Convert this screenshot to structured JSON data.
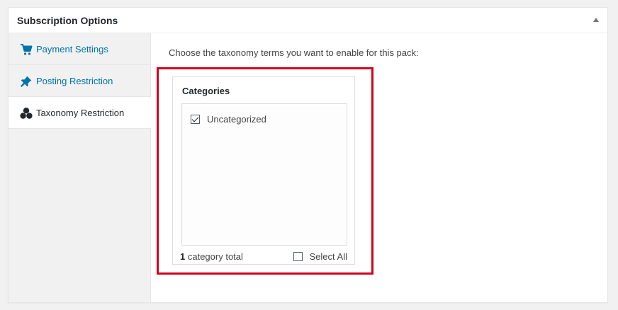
{
  "box": {
    "title": "Subscription Options"
  },
  "sidebar": {
    "items": [
      {
        "label": "Payment Settings",
        "icon": "cart-icon",
        "active": false
      },
      {
        "label": "Posting Restriction",
        "icon": "pin-icon",
        "active": false
      },
      {
        "label": "Taxonomy Restriction",
        "icon": "groups-icon",
        "active": true
      }
    ]
  },
  "main": {
    "intro": "Choose the taxonomy terms you want to enable for this pack:",
    "taxonomy": {
      "heading": "Categories",
      "terms": [
        {
          "label": "Uncategorized",
          "checked": true
        }
      ],
      "count": "1",
      "count_suffix": "category total",
      "select_all_label": "Select All",
      "select_all_checked": false
    }
  },
  "colors": {
    "link": "#0073aa",
    "highlight": "#d0021b",
    "sidebar_bg": "#f1f1f1"
  }
}
